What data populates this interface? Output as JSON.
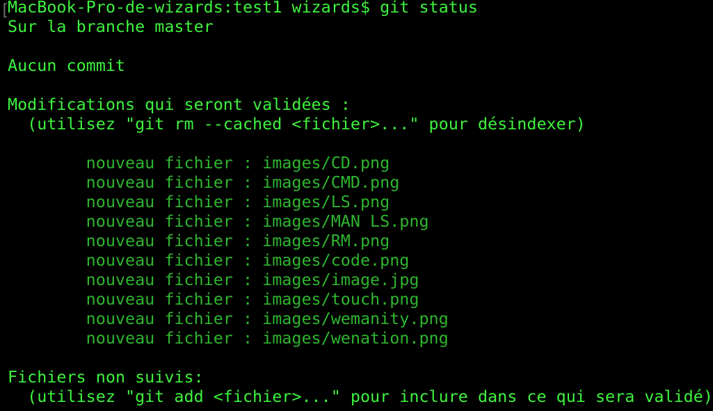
{
  "terminal": {
    "prompt": "MacBook-Pro-de-wizards:test1 wizards$ git status",
    "cursor_glyph": "[",
    "branch_line": "Sur la branche master",
    "no_commit": "Aucun commit",
    "staged_header": "Modifications qui seront validées :",
    "staged_hint": "  (utilisez \"git rm --cached <fichier>...\" pour désindexer)",
    "staged_files": [
      "        nouveau fichier : images/CD.png",
      "        nouveau fichier : images/CMD.png",
      "        nouveau fichier : images/LS.png",
      "        nouveau fichier : images/MAN LS.png",
      "        nouveau fichier : images/RM.png",
      "        nouveau fichier : images/code.png",
      "        nouveau fichier : images/image.jpg",
      "        nouveau fichier : images/touch.png",
      "        nouveau fichier : images/wemanity.png",
      "        nouveau fichier : images/wenation.png"
    ],
    "untracked_header": "Fichiers non suivis:",
    "untracked_hint": "  (utilisez \"git add <fichier>...\" pour inclure dans ce qui sera validé)"
  },
  "colors": {
    "background": "#000000",
    "text_bright": "#3ef23e",
    "text_dim": "#2fb52f"
  }
}
